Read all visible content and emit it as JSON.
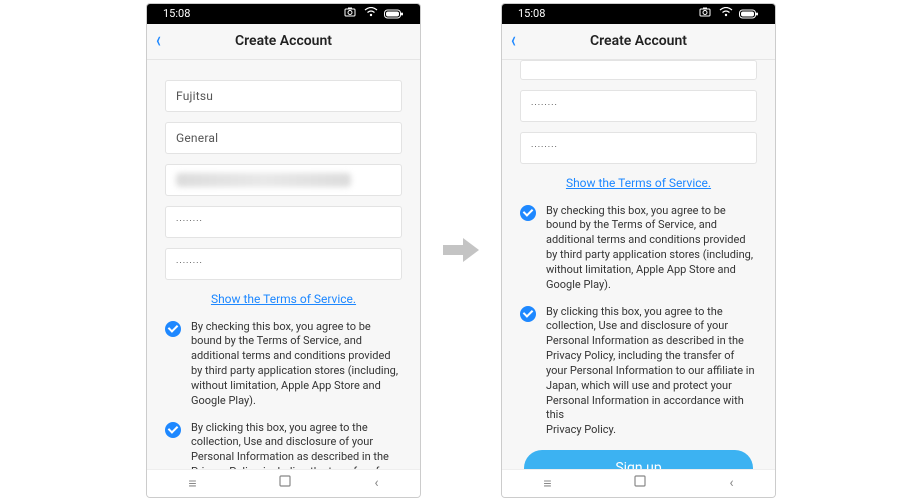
{
  "statusbar": {
    "time": "15:08"
  },
  "nav": {
    "title": "Create Account"
  },
  "left": {
    "fields": {
      "f1": "Fujitsu",
      "f2": "General",
      "f4": "········",
      "f5": "········"
    },
    "link": "Show the Terms of Service.",
    "agree1": "By checking this box, you agree to be bound by the Terms of Service, and additional terms and conditions provided by third party application stores (including, without limitation, Apple App Store and Google Play).",
    "agree2_partial": "By clicking this box, you agree to the collection, Use and disclosure of your Personal Information as described in the Privacy Policy, including the transfer of your Personal Information to our affiliate in"
  },
  "right": {
    "fields": {
      "f1": "········",
      "f2": "········"
    },
    "link": "Show the Terms of Service.",
    "agree1": "By checking this box, you agree to be bound by the Terms of Service, and additional terms and conditions provided by third party application stores (including, without limitation, Apple App Store and Google Play).",
    "agree2": "By clicking this box, you agree to the collection, Use and disclosure of your Personal Information as described in the Privacy Policy, including the transfer of your Personal Information to our affiliate in Japan, which will use and protect your Personal Information in accordance with this\nPrivacy Policy.",
    "signup": "Sign up"
  }
}
